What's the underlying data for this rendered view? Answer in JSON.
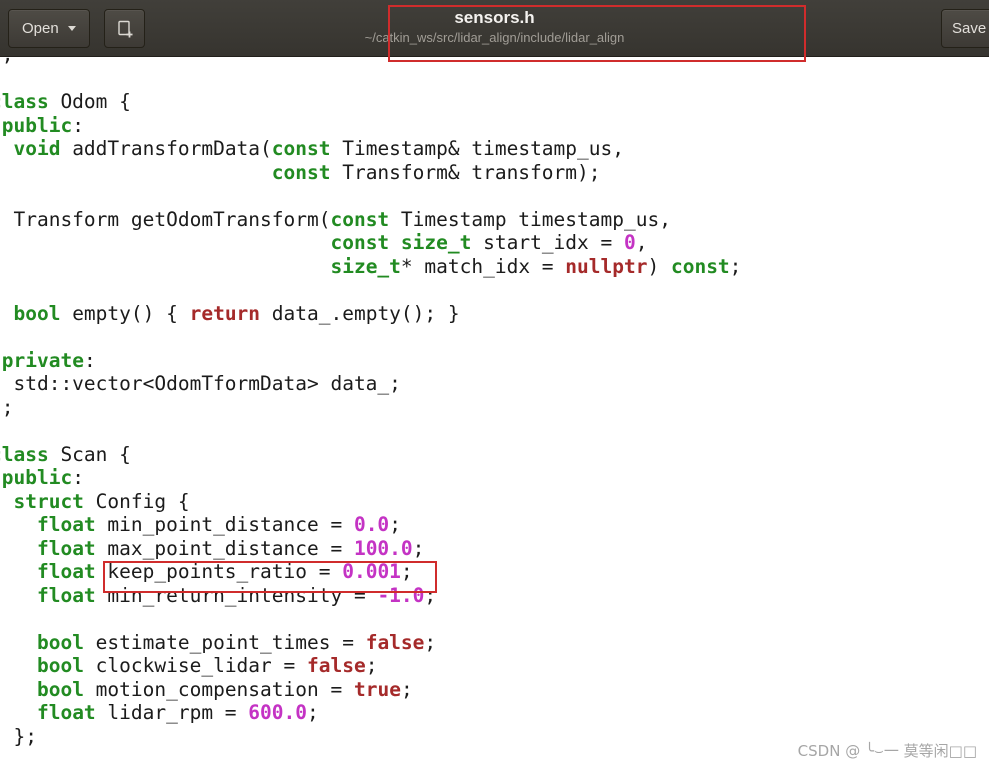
{
  "header": {
    "open_label": "Open",
    "save_label": "Save",
    "title": "sensors.h",
    "subtitle": "~/catkin_ws/src/lidar_align/include/lidar_align"
  },
  "icons": {
    "open_caret": "caret-down",
    "new_document": "new-document-plus"
  },
  "code": {
    "language": "cpp",
    "token_legend": {
      "p": "plain",
      "k": "type-or-keyword",
      "c": "flow-or-constant",
      "n": "number"
    },
    "lines": [
      [
        [
          "p",
          "};"
        ]
      ],
      [],
      [
        [
          "k",
          "class"
        ],
        [
          "p",
          " Odom {"
        ]
      ],
      [
        [
          "p",
          " "
        ],
        [
          "k",
          "public"
        ],
        [
          "p",
          ":"
        ]
      ],
      [
        [
          "p",
          "  "
        ],
        [
          "k",
          "void"
        ],
        [
          "p",
          " addTransformData("
        ],
        [
          "k",
          "const"
        ],
        [
          "p",
          " Timestamp& timestamp_us,"
        ]
      ],
      [
        [
          "p",
          "                        "
        ],
        [
          "k",
          "const"
        ],
        [
          "p",
          " Transform& transform);"
        ]
      ],
      [],
      [
        [
          "p",
          "  Transform getOdomTransform("
        ],
        [
          "k",
          "const"
        ],
        [
          "p",
          " Timestamp timestamp_us,"
        ]
      ],
      [
        [
          "p",
          "                             "
        ],
        [
          "k",
          "const"
        ],
        [
          "p",
          " "
        ],
        [
          "k",
          "size_t"
        ],
        [
          "p",
          " start_idx = "
        ],
        [
          "n",
          "0"
        ],
        [
          "p",
          ","
        ]
      ],
      [
        [
          "p",
          "                             "
        ],
        [
          "k",
          "size_t"
        ],
        [
          "p",
          "* match_idx = "
        ],
        [
          "c",
          "nullptr"
        ],
        [
          "p",
          ") "
        ],
        [
          "k",
          "const"
        ],
        [
          "p",
          ";"
        ]
      ],
      [],
      [
        [
          "p",
          "  "
        ],
        [
          "k",
          "bool"
        ],
        [
          "p",
          " empty() { "
        ],
        [
          "c",
          "return"
        ],
        [
          "p",
          " data_.empty(); }"
        ]
      ],
      [],
      [
        [
          "p",
          " "
        ],
        [
          "k",
          "private"
        ],
        [
          "p",
          ":"
        ]
      ],
      [
        [
          "p",
          "  std::vector<OdomTformData> data_;"
        ]
      ],
      [
        [
          "p",
          "};"
        ]
      ],
      [],
      [
        [
          "k",
          "class"
        ],
        [
          "p",
          " Scan {"
        ]
      ],
      [
        [
          "p",
          " "
        ],
        [
          "k",
          "public"
        ],
        [
          "p",
          ":"
        ]
      ],
      [
        [
          "p",
          "  "
        ],
        [
          "k",
          "struct"
        ],
        [
          "p",
          " Config {"
        ]
      ],
      [
        [
          "p",
          "    "
        ],
        [
          "k",
          "float"
        ],
        [
          "p",
          " min_point_distance = "
        ],
        [
          "n",
          "0.0"
        ],
        [
          "p",
          ";"
        ]
      ],
      [
        [
          "p",
          "    "
        ],
        [
          "k",
          "float"
        ],
        [
          "p",
          " max_point_distance = "
        ],
        [
          "n",
          "100.0"
        ],
        [
          "p",
          ";"
        ]
      ],
      [
        [
          "p",
          "    "
        ],
        [
          "k",
          "float"
        ],
        [
          "p",
          " keep_points_ratio = "
        ],
        [
          "n",
          "0.001"
        ],
        [
          "p",
          ";"
        ]
      ],
      [
        [
          "p",
          "    "
        ],
        [
          "k",
          "float"
        ],
        [
          "p",
          " min_return_intensity = "
        ],
        [
          "n",
          "-1.0"
        ],
        [
          "p",
          ";"
        ]
      ],
      [],
      [
        [
          "p",
          "    "
        ],
        [
          "k",
          "bool"
        ],
        [
          "p",
          " estimate_point_times = "
        ],
        [
          "c",
          "false"
        ],
        [
          "p",
          ";"
        ]
      ],
      [
        [
          "p",
          "    "
        ],
        [
          "k",
          "bool"
        ],
        [
          "p",
          " clockwise_lidar = "
        ],
        [
          "c",
          "false"
        ],
        [
          "p",
          ";"
        ]
      ],
      [
        [
          "p",
          "    "
        ],
        [
          "k",
          "bool"
        ],
        [
          "p",
          " motion_compensation = "
        ],
        [
          "c",
          "true"
        ],
        [
          "p",
          ";"
        ]
      ],
      [
        [
          "p",
          "    "
        ],
        [
          "k",
          "float"
        ],
        [
          "p",
          " lidar_rpm = "
        ],
        [
          "n",
          "600.0"
        ],
        [
          "p",
          ";"
        ]
      ],
      [
        [
          "p",
          "  };"
        ]
      ]
    ]
  },
  "annotations": {
    "title_box": "red box around window title",
    "code_box": "red box around keep_points_ratio = 0.001"
  },
  "watermark": "CSDN @ ╰⌣一 莫等闲□□",
  "colors": {
    "annotation_red": "#D02C2C",
    "keyword_green": "#228B22",
    "flow_red": "#A52A2A",
    "number_magenta": "#C433C4",
    "header_bg": "#3B3934",
    "code_fg": "#1B1B1B"
  }
}
